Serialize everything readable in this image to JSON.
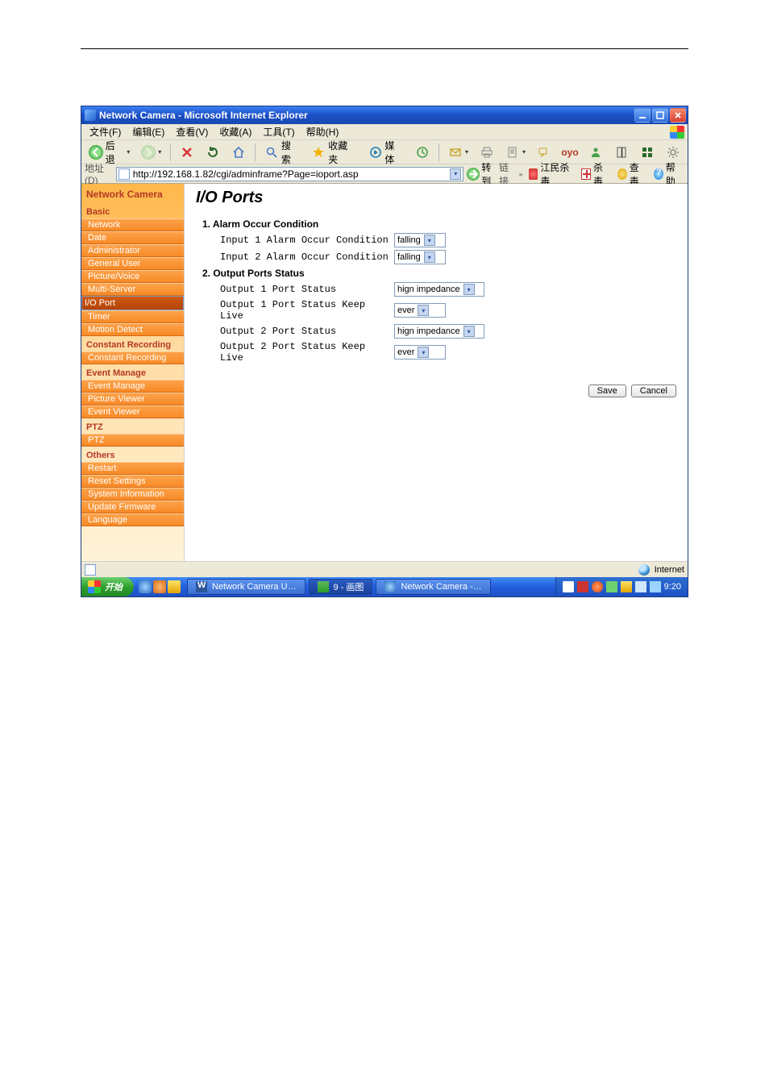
{
  "window": {
    "title": "Network Camera - Microsoft Internet Explorer"
  },
  "menu": {
    "file": "文件(F)",
    "edit": "编辑(E)",
    "view": "查看(V)",
    "favorites": "收藏(A)",
    "tools": "工具(T)",
    "help": "帮助(H)"
  },
  "toolbar": {
    "back": "后退",
    "search": "搜索",
    "favorites": "收藏夹",
    "media": "媒体"
  },
  "addressbar": {
    "label": "地址(D)",
    "url": "http://192.168.1.82/cgi/adminframe?Page=ioport.asp",
    "go": "转到",
    "links": "链接",
    "ext1": "江民杀毒",
    "ext2": "杀毒",
    "ext3": "查毒",
    "ext4": "帮助"
  },
  "sidebar": {
    "header": "Network Camera",
    "groups": {
      "basic": "Basic",
      "constant_recording": "Constant Recording",
      "event_manage": "Event Manage",
      "ptz": "PTZ",
      "others": "Others"
    },
    "items": {
      "network": "Network",
      "date": "Date",
      "administrator": "Administrator",
      "general_user": "General User",
      "picture_voice": "Picture/Voice",
      "multi_server": "Multi-Server",
      "io_port": "I/O Port",
      "timer": "Timer",
      "motion_detect": "Motion Detect",
      "constant_recording": "Constant Recording",
      "event_manage": "Event Manage",
      "picture_viewer": "Picture Viewer",
      "event_viewer": "Event Viewer",
      "ptz": "PTZ",
      "restart": "Restart",
      "reset_settings": "Reset Settings",
      "system_information": "System Information",
      "update_firmware": "Update Firmware",
      "language": "Language"
    }
  },
  "main": {
    "title": "I/O Ports",
    "section1": "1. Alarm Occur Condition",
    "input1_label": "Input 1 Alarm Occur Condition",
    "input1_value": "falling",
    "input2_label": "Input 2 Alarm Occur Condition",
    "input2_value": "falling",
    "section2": "2. Output Ports Status",
    "out1_label": "Output 1 Port Status",
    "out1_value": "hign impedance",
    "out1keep_label": "Output 1 Port Status Keep Live",
    "out1keep_value": "ever",
    "out2_label": "Output 2 Port Status",
    "out2_value": "hign impedance",
    "out2keep_label": "Output 2 Port Status Keep Live",
    "out2keep_value": "ever",
    "save": "Save",
    "cancel": "Cancel"
  },
  "status": {
    "zone": "Internet"
  },
  "taskbar": {
    "start": "开始",
    "task1": "Network Camera U…",
    "task2": "9 - 画图",
    "task3": "Network Camera -…",
    "clock": "9:20"
  }
}
